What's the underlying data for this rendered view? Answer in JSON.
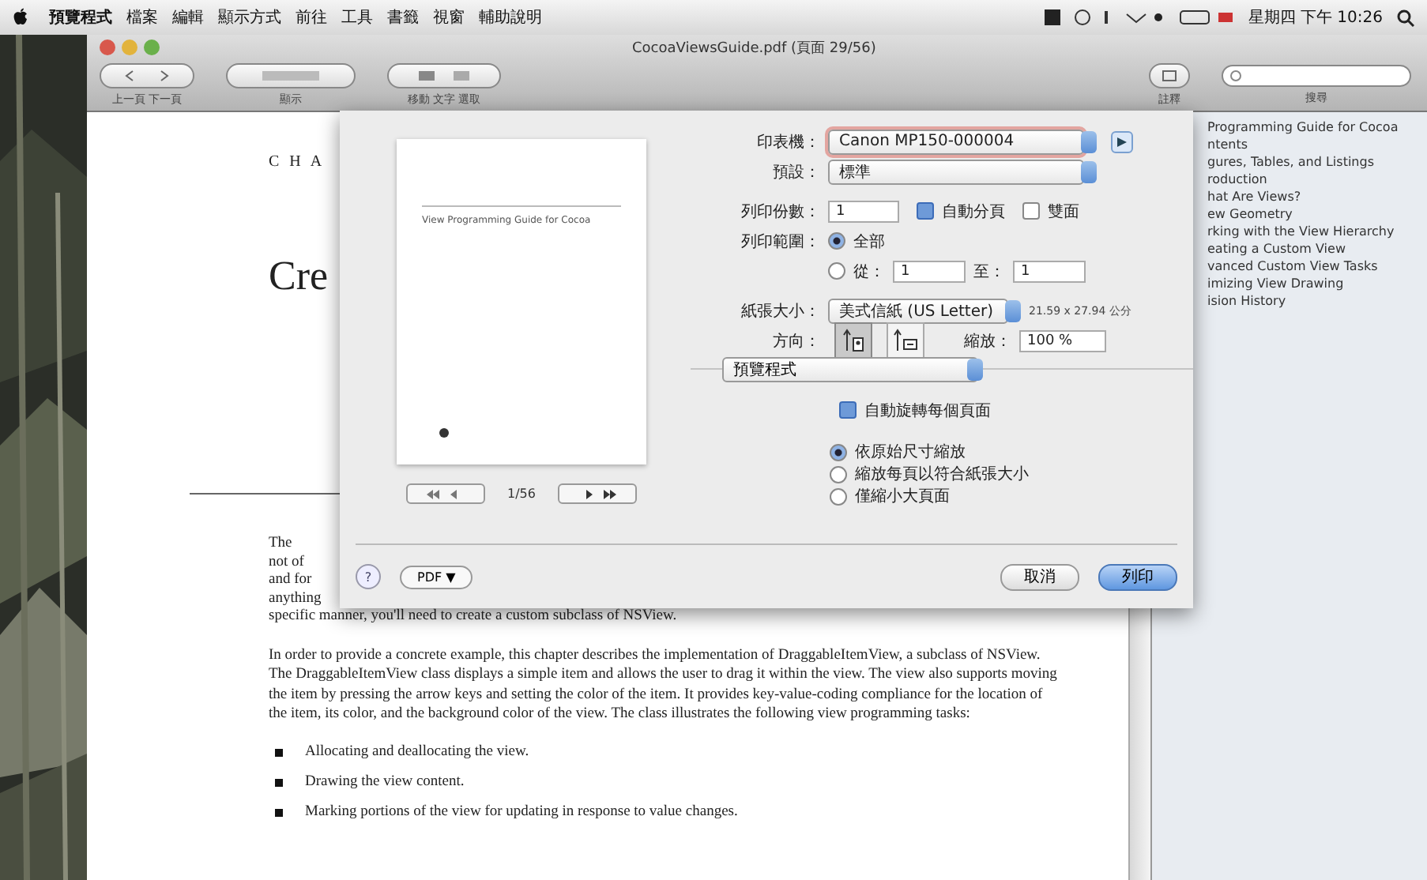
{
  "menubar": {
    "items": [
      "預覽程式",
      "檔案",
      "編輯",
      "顯示方式",
      "前往",
      "工具",
      "書籤",
      "視窗",
      "輔助說明"
    ],
    "clock": "星期四 下午 10:26"
  },
  "window": {
    "title": "CocoaViewsGuide.pdf (頁面 29/56)",
    "toolbar_left": [
      "上一頁 下一頁",
      "顯示",
      "移動 文字 選取"
    ],
    "toolbar_right": [
      "註釋",
      "搜尋"
    ]
  },
  "document": {
    "chapter_mark": "C H A",
    "title_fragment": "Cre",
    "fragments": [
      "The",
      "not of",
      "and for",
      "anything"
    ],
    "line_after": "specific manner, you'll need to create a custom subclass of NSView.",
    "paragraph": "In order to provide a concrete example, this chapter describes the implementation of DraggableItemView, a subclass of NSView. The DraggableItemView class displays a simple item and allows the user to drag it within the view. The view also supports moving the item by pressing the arrow keys and setting the color of the item. It provides key-value-coding compliance for the location of the item, its color, and the background color of the view. The class illustrates the following view programming tasks:",
    "bullets": [
      "Allocating and deallocating the view.",
      "Drawing the view content.",
      "Marking portions of the view for updating in response to value changes."
    ]
  },
  "sidebar": {
    "items": [
      "Programming Guide for Cocoa",
      "ntents",
      "gures, Tables, and Listings",
      "roduction",
      "hat Are Views?",
      "ew Geometry",
      "rking with the View Hierarchy",
      "eating a Custom View",
      "vanced Custom View Tasks",
      "imizing View Drawing",
      "ision History"
    ]
  },
  "print_dialog": {
    "preview_title": "View Programming Guide for Cocoa",
    "page_counter": "1/56",
    "printer": {
      "label": "印表機：",
      "value": "Canon MP150-000004"
    },
    "presets": {
      "label": "預設：",
      "value": "標準"
    },
    "copies": {
      "label": "列印份數：",
      "value": "1",
      "collate": {
        "label": "自動分頁",
        "checked": true
      },
      "two_sided": {
        "label": "雙面",
        "checked": false
      }
    },
    "pages": {
      "label": "列印範圍：",
      "options": [
        {
          "label": "全部",
          "selected": true
        },
        {
          "label": "從：",
          "selected": false
        }
      ],
      "from": "1",
      "to_label": "至：",
      "to": "1"
    },
    "paper": {
      "label": "紙張大小：",
      "value": "美式信紙 (US Letter)",
      "size": "21.59 x 27.94 公分"
    },
    "orientation": {
      "label": "方向：",
      "options": [
        {
          "kind": "portrait",
          "selected": true
        },
        {
          "kind": "landscape",
          "selected": false
        }
      ]
    },
    "scale": {
      "label": "縮放：",
      "value": "100 %"
    },
    "section": "預覽程式",
    "auto_rotate": {
      "label": "自動旋轉每個頁面",
      "checked": true
    },
    "scaling": [
      {
        "label": "依原始尺寸縮放",
        "selected": true
      },
      {
        "label": "縮放每頁以符合紙張大小",
        "selected": false
      },
      {
        "label": "僅縮小大頁面",
        "selected": false
      }
    ],
    "help": "?",
    "pdf": "PDF ▼",
    "cancel": "取消",
    "print": "列印"
  }
}
